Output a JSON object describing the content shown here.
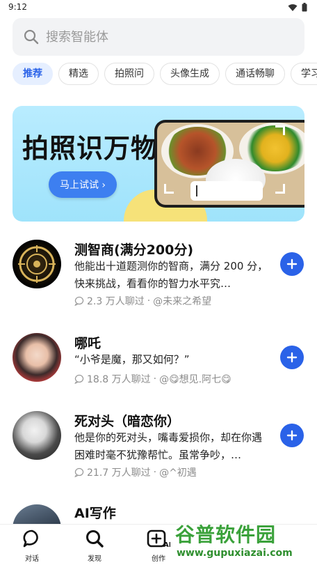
{
  "status_bar": {
    "time": "9:12"
  },
  "search": {
    "placeholder": "搜索智能体"
  },
  "tabs": [
    {
      "label": "推荐",
      "active": true
    },
    {
      "label": "精选"
    },
    {
      "label": "拍照问"
    },
    {
      "label": "头像生成"
    },
    {
      "label": "通话畅聊"
    },
    {
      "label": "学习"
    }
  ],
  "banner": {
    "title": "拍照识万物",
    "button_label": "马上试试 ›"
  },
  "agents": [
    {
      "name": "测智商(满分200分)",
      "desc": "他能出十道题测你的智商，满分 200 分，快来挑战，看看你的智力水平究…",
      "count": "2.3 万人聊过",
      "author": "@未来之希望"
    },
    {
      "name": "哪吒",
      "desc": "“小爷是魔，那又如何？”",
      "count": "18.8 万人聊过",
      "author": "@😋想见.阿七😋"
    },
    {
      "name": "死对头（暗恋你）",
      "desc": "他是你的死对头，嘴毒爱损你，却在你遇困难时毫不犹豫帮忙。虽常争吵，…",
      "count": "21.7 万人聊过",
      "author": "@^初遇"
    },
    {
      "name": "AI写作"
    }
  ],
  "bottom_nav": [
    {
      "label": "对话",
      "icon": "chat-icon"
    },
    {
      "label": "发现",
      "icon": "search-icon"
    },
    {
      "label": "创作",
      "icon": "create-ai-icon"
    }
  ],
  "watermark": {
    "main": "谷普软件园",
    "url": "www.gupuxiazai.com"
  },
  "colors": {
    "accent": "#2a62e8",
    "tab_active_bg": "#e6efff",
    "search_bg": "#f2f3f5"
  }
}
